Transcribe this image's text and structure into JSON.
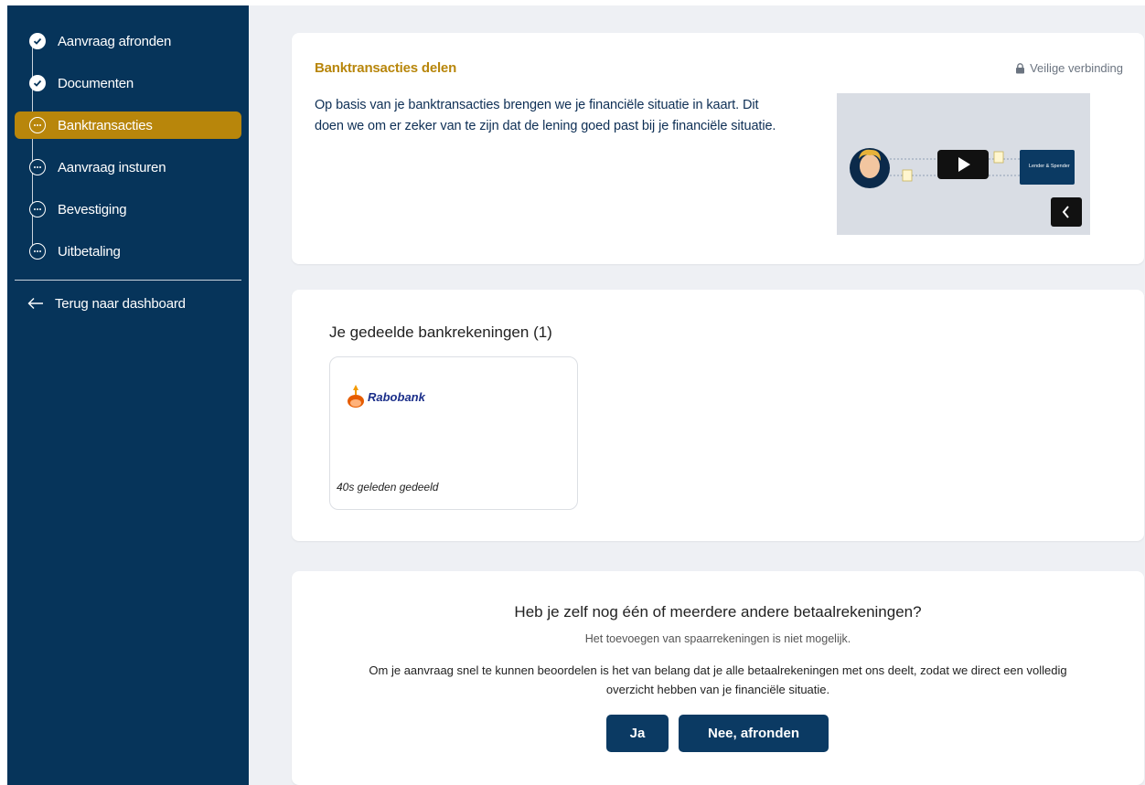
{
  "sidebar": {
    "steps": [
      {
        "label": "Aanvraag afronden",
        "status": "done"
      },
      {
        "label": "Documenten",
        "status": "done"
      },
      {
        "label": "Banktransacties",
        "status": "active"
      },
      {
        "label": "Aanvraag insturen",
        "status": "pending"
      },
      {
        "label": "Bevestiging",
        "status": "pending"
      },
      {
        "label": "Uitbetaling",
        "status": "pending"
      }
    ],
    "back_label": "Terug naar dashboard"
  },
  "intro_card": {
    "title": "Banktransacties delen",
    "secure_label": "Veilige verbinding",
    "text": "Op basis van je banktransacties brengen we je financiële situatie in kaart. Dit doen we om er zeker van te zijn dat de lening goed past bij je financiële situatie.",
    "video": {
      "box_label": "Lender & Spender"
    }
  },
  "accounts_card": {
    "heading": "Je gedeelde bankrekeningen (1)",
    "accounts": [
      {
        "bank": "Rabobank",
        "shared": "40s geleden gedeeld"
      }
    ]
  },
  "more_card": {
    "question": "Heb je zelf nog één of meerdere andere betaalrekeningen?",
    "note": "Het toevoegen van spaarrekeningen is niet mogelijk.",
    "body": "Om je aanvraag snel te kunnen beoordelen is het van belang dat je alle betaalrekeningen met ons deelt, zodat we direct een volledig overzicht hebben van je financiële situatie.",
    "yes_label": "Ja",
    "no_label": "Nee, afronden"
  },
  "colors": {
    "sidebar_bg": "#06345a",
    "accent": "#b8860b",
    "button_bg": "#0b3a63",
    "main_bg": "#eef0f4"
  }
}
